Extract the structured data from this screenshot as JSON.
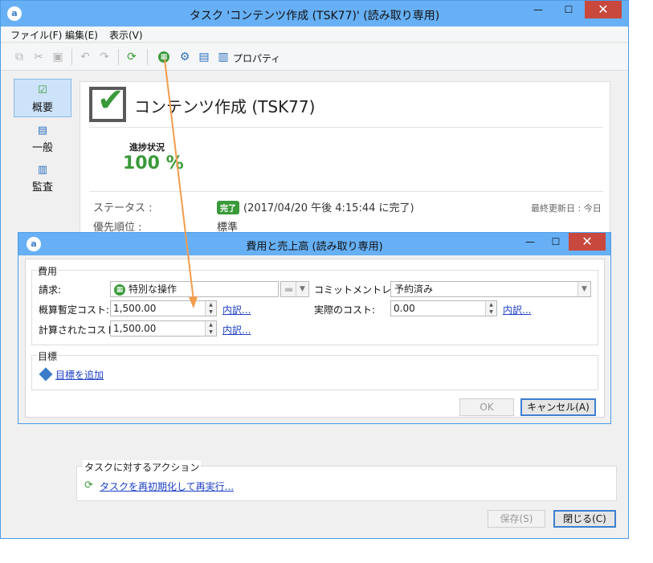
{
  "main_window": {
    "title": "タスク 'コンテンツ作成 (TSK77)' (読み取り専用)",
    "controls": {
      "minimize": "—",
      "maximize": "☐",
      "close": "✕"
    }
  },
  "menu": [
    {
      "label": "ファイル(F)"
    },
    {
      "label": "編集(E)"
    },
    {
      "label": "表示(V)"
    }
  ],
  "toolbar": {
    "properties_label": "プロパティ"
  },
  "nav": [
    {
      "label": "概要",
      "selected": true
    },
    {
      "label": "一般",
      "selected": false
    },
    {
      "label": "監査",
      "selected": false
    }
  ],
  "task": {
    "title": "コンテンツ作成 (TSK77)",
    "progress_label": "進捗状況",
    "progress_value": "100 %",
    "status_label": "ステータス :",
    "status_badge": "完了",
    "status_text": "(2017/04/20 午後 4:15:44 に完了)",
    "last_updated": "最終更新日 : 今日",
    "priority_label": "優先順位 :",
    "priority_value": "標準"
  },
  "actions": {
    "title": "タスクに対するアクション",
    "reinit_link": "タスクを再初期化して再実行..."
  },
  "footer": {
    "save_button": "保存(S)",
    "close_button": "閉じる(C)"
  },
  "dialog": {
    "title": "費用と売上高 (読み取り専用)",
    "cost_group": "費用",
    "billing_label": "請求:",
    "billing_value": "特別な操作",
    "commitment_label": "コミットメントレベル:",
    "commitment_value": "予約済み",
    "estimated_cost_label": "概算暫定コスト:",
    "estimated_cost_value": "1,500.00",
    "actual_cost_label": "実際のコスト:",
    "actual_cost_value": "0.00",
    "calculated_cost_label": "計算されたコスト:",
    "calculated_cost_value": "1,500.00",
    "breakdown_link": "内訳...",
    "goal_group": "目標",
    "add_goal_link": "目標を追加",
    "ok_button": "OK",
    "cancel_button": "キャンセル(A)"
  },
  "colors": {
    "titlebar": "#67b0f5",
    "close_button": "#c9483d",
    "success_green": "#3a9a3a",
    "link_blue": "#1c3fc5",
    "annotation_arrow": "#f39c4b"
  }
}
